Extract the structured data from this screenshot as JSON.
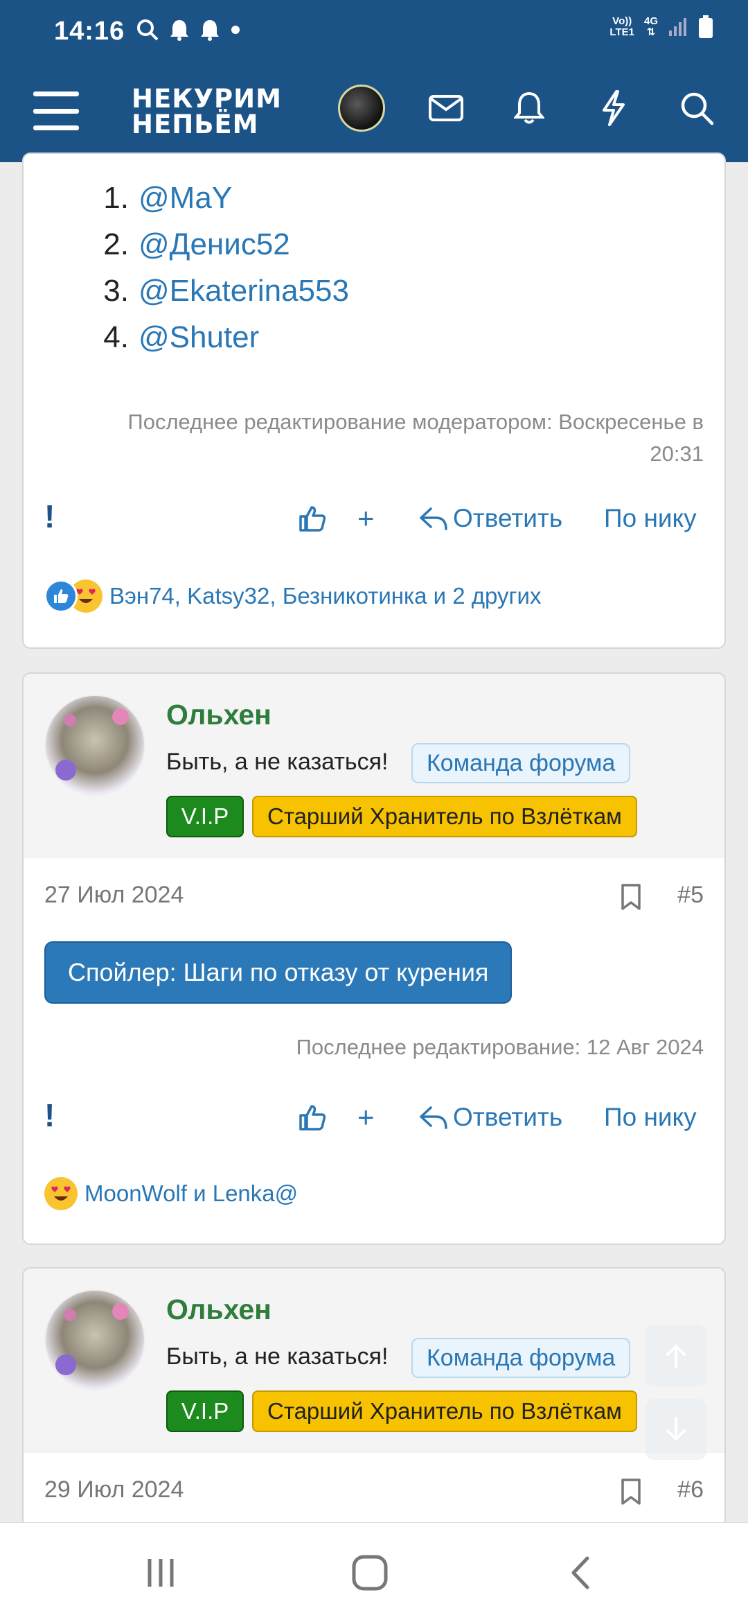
{
  "status_bar": {
    "time": "14:16",
    "network_line1": "Vo))",
    "network_line2": "LTE1",
    "network_type": "4G"
  },
  "header": {
    "logo_line1": "НЕКУРИМ",
    "logo_line2": "НЕПЬЁМ",
    "icons": [
      "menu-icon",
      "avatar",
      "mail-icon",
      "bell-icon",
      "bolt-icon",
      "search-icon"
    ]
  },
  "post1": {
    "list": [
      {
        "num": "1.",
        "name": "@MaY"
      },
      {
        "num": "2.",
        "name": "@Денис52"
      },
      {
        "num": "3.",
        "name": "@Ekaterina553"
      },
      {
        "num": "4.",
        "name": "@Shuter"
      }
    ],
    "edited_line1": "Последнее редактирование модератором: Воскресенье в",
    "edited_line2": "20:31",
    "reply": "Ответить",
    "by_nick": "По нику",
    "plus": "+",
    "reactions_text": "Вэн74, Katsy32, Безникотинка и 2 других"
  },
  "post2": {
    "username": "Ольхен",
    "user_title": "Быть, а не казаться!",
    "team_badge": "Команда форума",
    "vip_badge": "V.I.P",
    "keeper_badge": "Старший Хранитель по Взлёткам",
    "date": "27 Июл 2024",
    "number": "#5",
    "spoiler": "Спойлер: Шаги по отказу от курения",
    "edited": "Последнее редактирование: 12 Авг 2024",
    "reply": "Ответить",
    "by_nick": "По нику",
    "plus": "+",
    "reactions_text": "MoonWolf и Lenka@"
  },
  "post3": {
    "username": "Ольхен",
    "user_title": "Быть, а не казаться!",
    "team_badge": "Команда форума",
    "vip_badge": "V.I.P",
    "keeper_badge": "Старший Хранитель по Взлёткам",
    "date": "29 Июл 2024",
    "number": "#6"
  },
  "colors": {
    "header_bg": "#1c5387",
    "link": "#2a77b5",
    "username": "#2f7d3c",
    "vip": "#1d8a1d",
    "keeper": "#f7c200",
    "spoiler": "#2c79b9"
  }
}
